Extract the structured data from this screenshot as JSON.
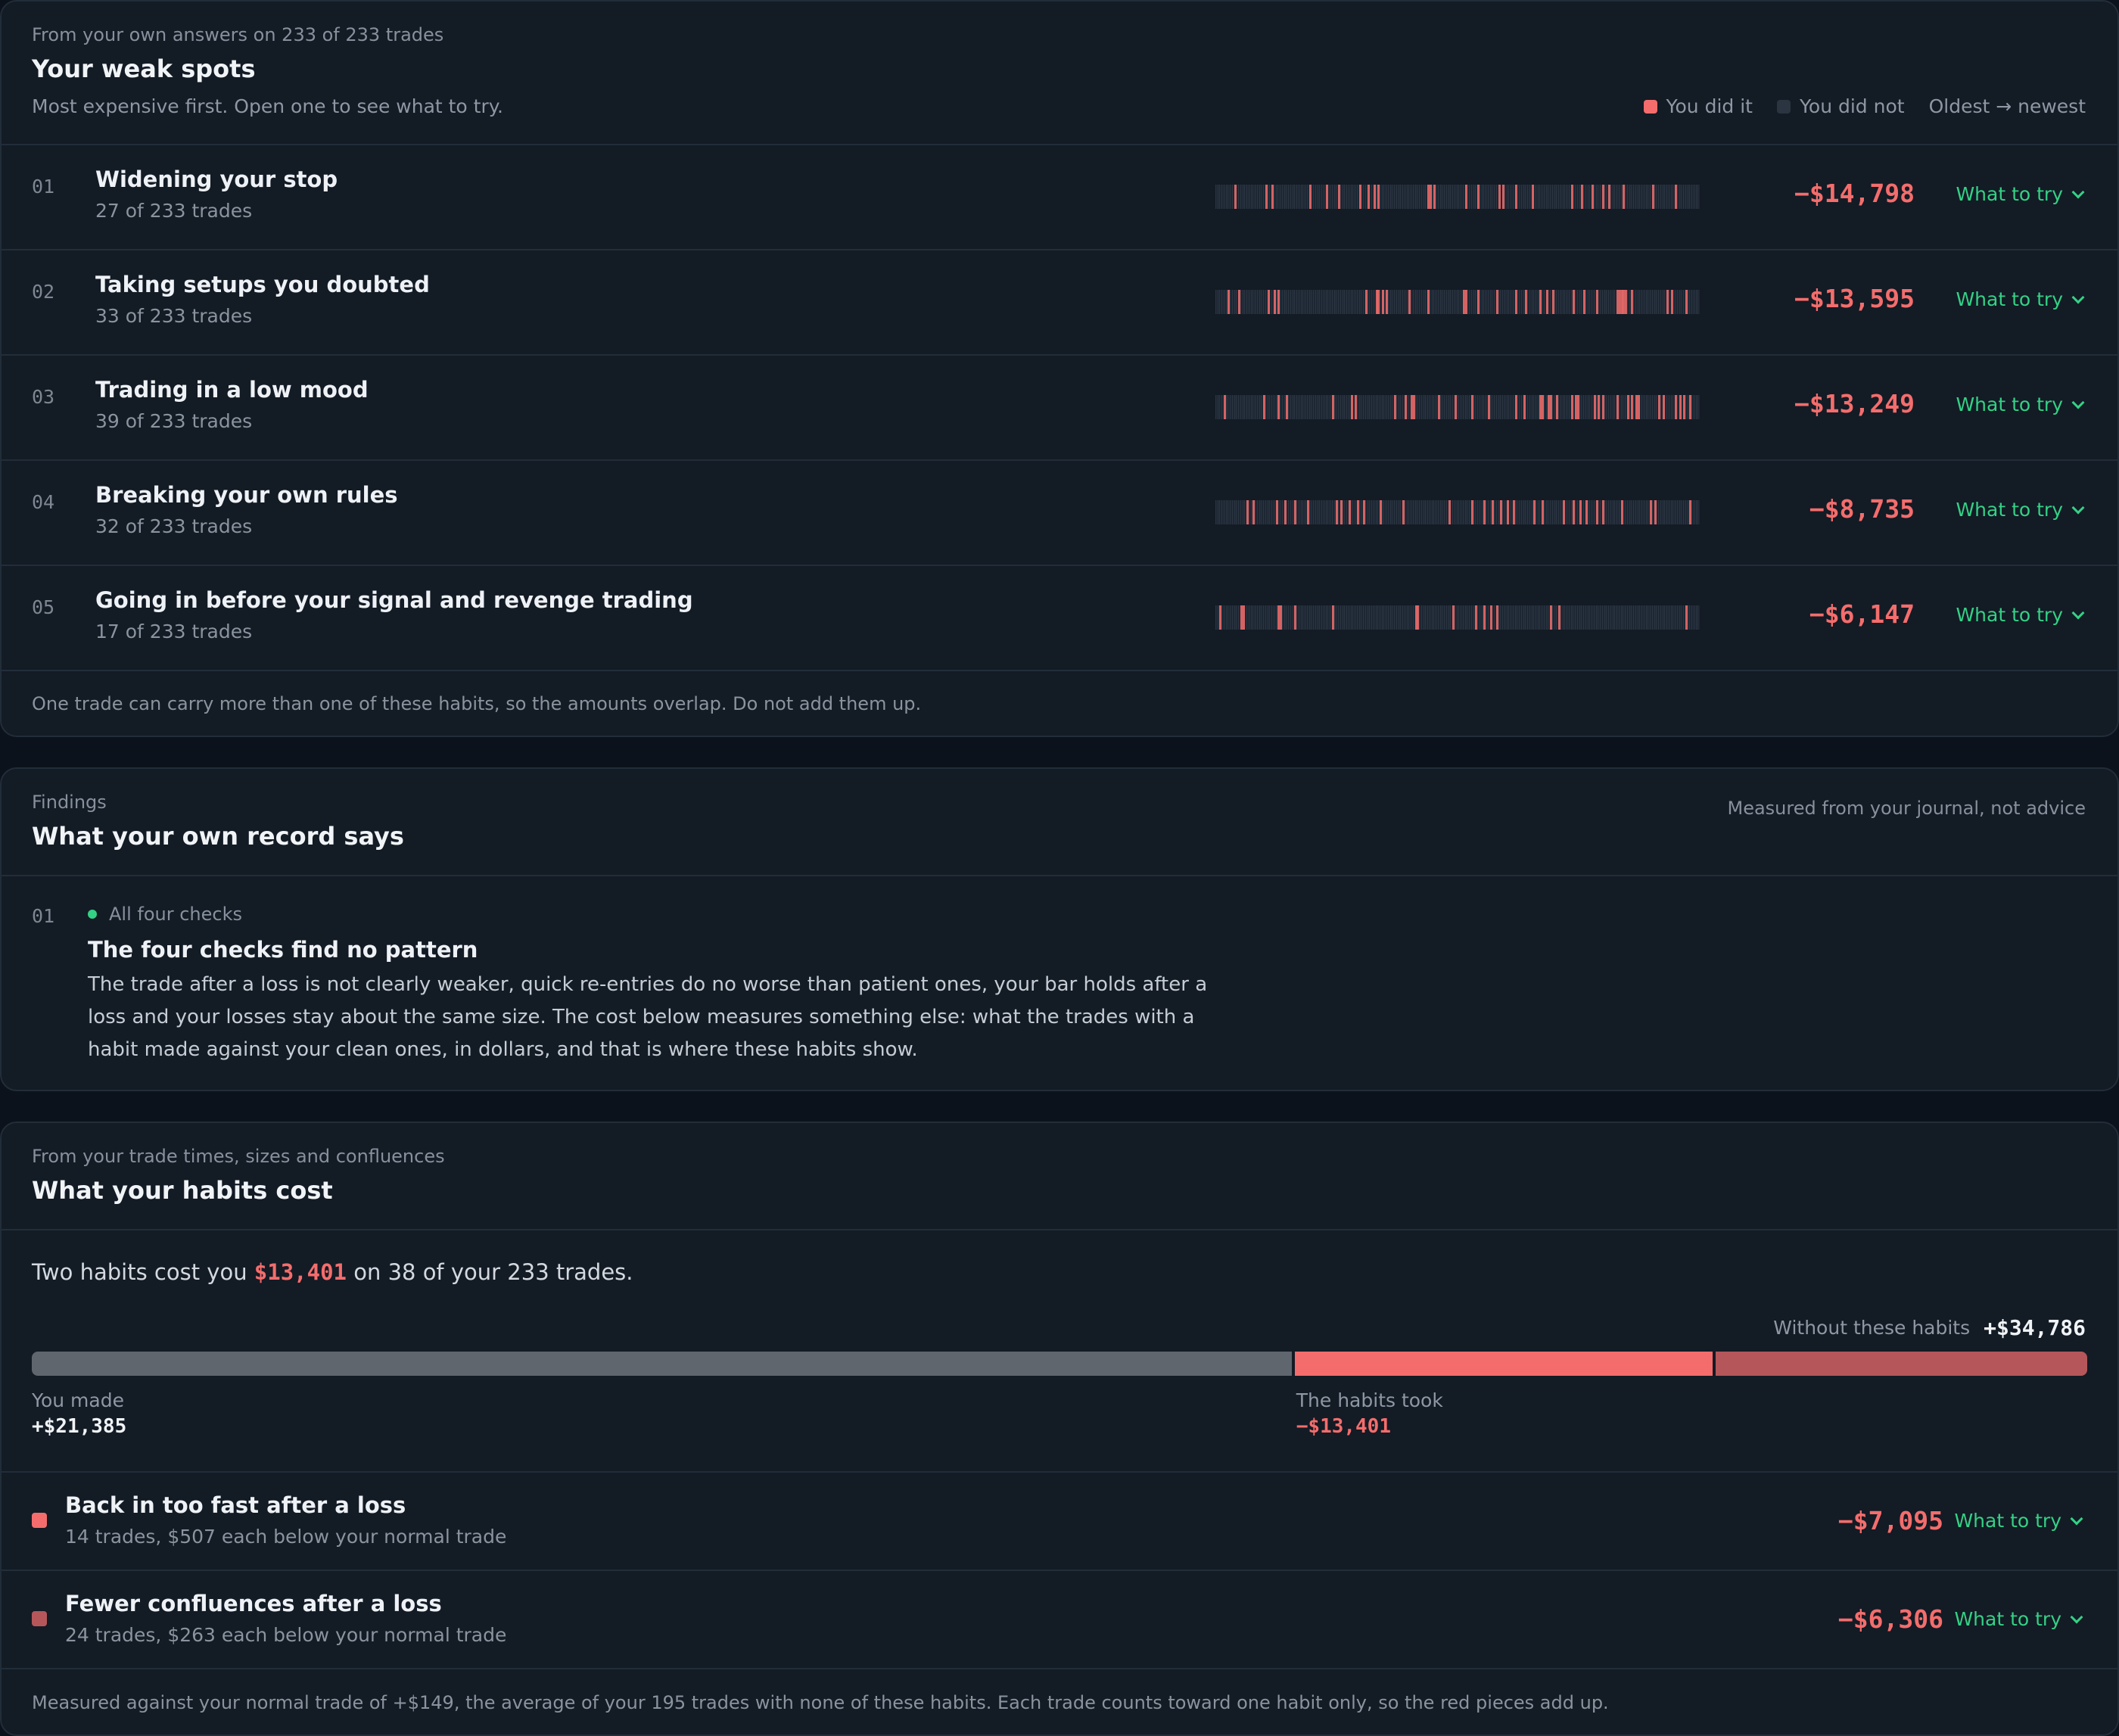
{
  "weak_spots": {
    "eyebrow": "From your own answers on 233 of 233 trades",
    "title": "Your weak spots",
    "subtitle": "Most expensive first. Open one to see what to try.",
    "legend": {
      "did": "You did it",
      "did_not": "You did not",
      "order": "Oldest → newest"
    },
    "colors": {
      "did": "#f46d6c",
      "did_not": "#2b3541",
      "accent": "#34d185"
    },
    "rows": [
      {
        "num": "01",
        "title": "Widening your stop",
        "sub": "27 of 233 trades",
        "amount": "−$14,798",
        "action": "What to try",
        "count": 27,
        "seed": 11
      },
      {
        "num": "02",
        "title": "Taking setups you doubted",
        "sub": "33 of 233 trades",
        "amount": "−$13,595",
        "action": "What to try",
        "count": 33,
        "seed": 23
      },
      {
        "num": "03",
        "title": "Trading in a low mood",
        "sub": "39 of 233 trades",
        "amount": "−$13,249",
        "action": "What to try",
        "count": 39,
        "seed": 37
      },
      {
        "num": "04",
        "title": "Breaking your own rules",
        "sub": "32 of 233 trades",
        "amount": "−$8,735",
        "action": "What to try",
        "count": 32,
        "seed": 41
      },
      {
        "num": "05",
        "title": "Going in before your signal and revenge trading",
        "sub": "17 of 233 trades",
        "amount": "−$6,147",
        "action": "What to try",
        "count": 17,
        "seed": 53
      }
    ],
    "total_trades": 233,
    "footer": "One trade can carry more than one of these habits, so the amounts overlap. Do not add them up."
  },
  "findings": {
    "eyebrow": "Findings",
    "title": "What your own record says",
    "note": "Measured from your journal, not advice",
    "items": [
      {
        "num": "01",
        "tag": "All four checks",
        "title": "The four checks find no pattern",
        "body": "The trade after a loss is not clearly weaker, quick re-entries do no worse than patient ones, your bar holds after a loss and your losses stay about the same size. The cost below measures something else: what the trades with a habit made against your clean ones, in dollars, and that is where these habits show."
      }
    ]
  },
  "habits": {
    "eyebrow": "From your trade times, sizes and confluences",
    "title": "What your habits cost",
    "summary": {
      "before": "Two habits cost you ",
      "amount": "$13,401",
      "after": " on 38 of your 233 trades."
    },
    "without_label": "Without these habits",
    "without_value": "+$34,786",
    "made_label": "You made",
    "made_value": "+$21,385",
    "took_label": "The habits took",
    "took_value": "−$13,401",
    "bar": {
      "made": 21385,
      "habit1": 7095,
      "habit2": 6306,
      "colors": {
        "made": "#5f666d",
        "habit1": "#f46d6c",
        "habit2": "#b5575a"
      }
    },
    "items": [
      {
        "title": "Back in too fast after a loss",
        "sub": "14 trades, $507 each below your normal trade",
        "amount": "−$7,095",
        "action": "What to try",
        "color": "#f46d6c"
      },
      {
        "title": "Fewer confluences after a loss",
        "sub": "24 trades, $263 each below your normal trade",
        "amount": "−$6,306",
        "action": "What to try",
        "color": "#b5575a"
      }
    ],
    "footer": "Measured against your normal trade of +$149, the average of your 195 trades with none of these habits. Each trade counts toward one habit only, so the red pieces add up."
  }
}
